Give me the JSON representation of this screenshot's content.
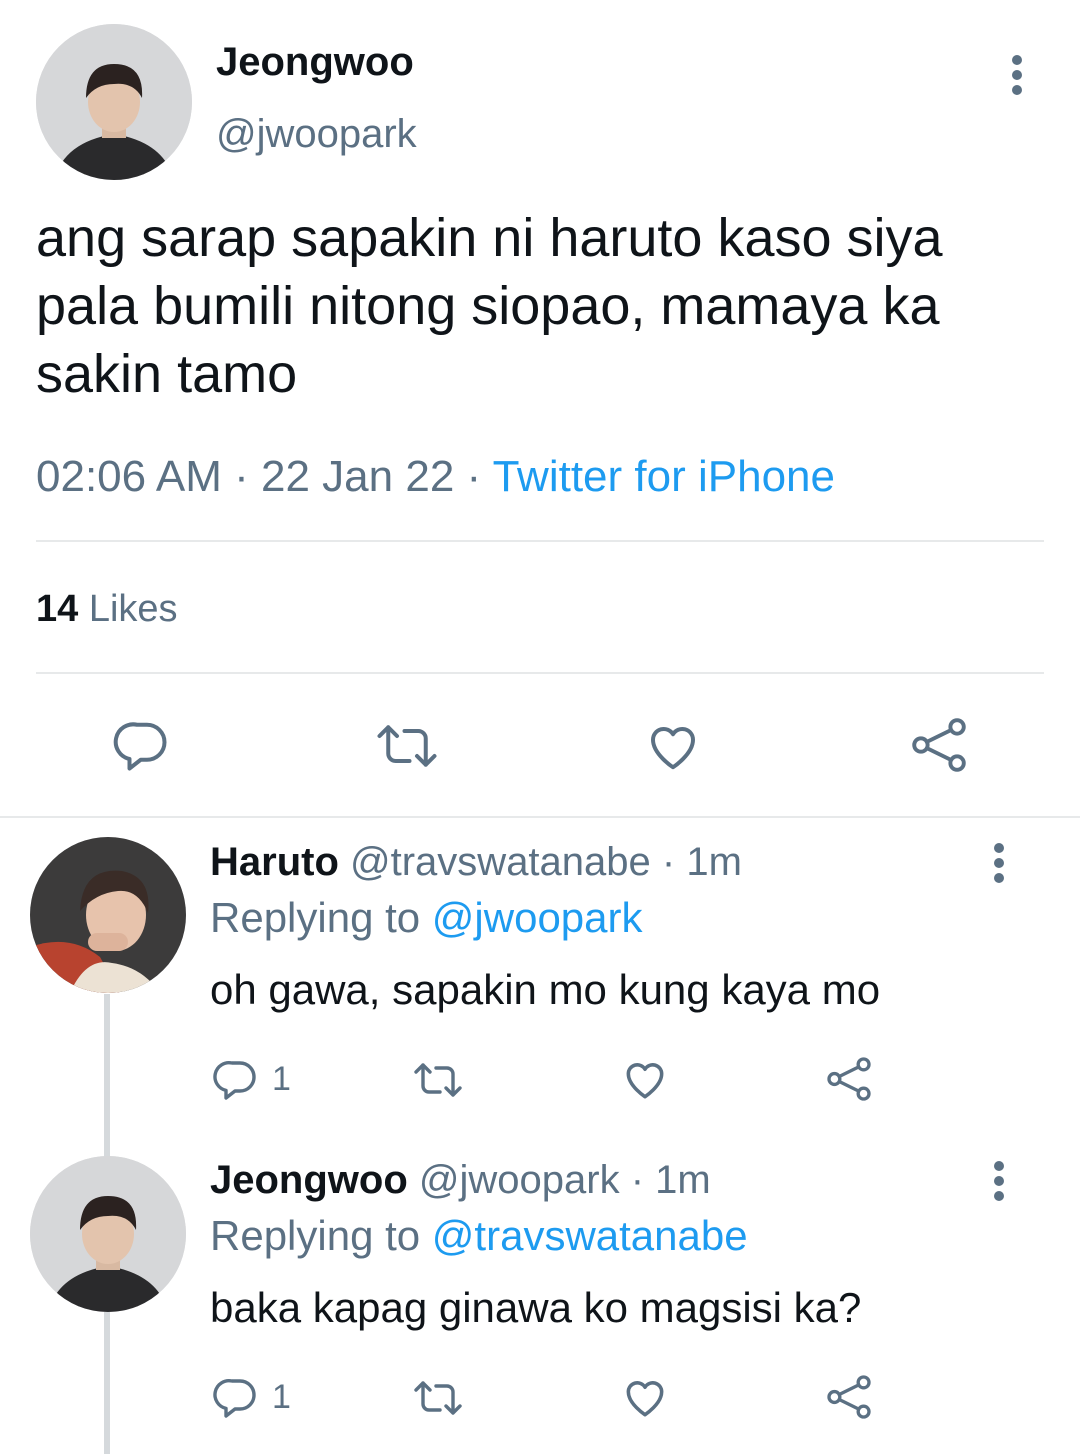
{
  "main_tweet": {
    "author_name": "Jeongwoo",
    "author_handle": "@jwoopark",
    "text": "ang sarap sapakin ni haruto kaso siya pala bumili nitong siopao, mamaya ka sakin tamo",
    "time": "02:06 AM",
    "date_sep": " · ",
    "date": "22 Jan 22",
    "source_sep": " · ",
    "source": "Twitter for iPhone",
    "likes_count": "14",
    "likes_label": "Likes"
  },
  "replies": [
    {
      "author_name": "Haruto",
      "author_handle": "@travswatanabe",
      "age": " · 1m",
      "replying_label": "Replying to",
      "replying_to": "@jwoopark",
      "text": "oh gawa, sapakin mo kung kaya mo",
      "reply_count": "1"
    },
    {
      "author_name": "Jeongwoo",
      "author_handle": "@jwoopark",
      "age": " · 1m",
      "replying_label": "Replying to",
      "replying_to": "@travswatanabe",
      "text": "baka kapag ginawa ko magsisi ka?",
      "reply_count": "1"
    }
  ],
  "icons": [
    "more-icon",
    "reply-icon",
    "retweet-icon",
    "like-icon",
    "share-icon"
  ],
  "colors": {
    "text": "#0f1419",
    "muted": "#5b7083",
    "link": "#1d9bf0",
    "divider": "#e7e9ea"
  }
}
